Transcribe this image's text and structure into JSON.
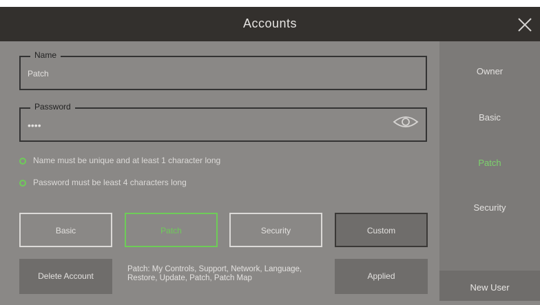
{
  "header": {
    "title": "Accounts"
  },
  "form": {
    "name_label": "Name",
    "name_value": "Patch",
    "password_label": "Password",
    "password_value": "••••"
  },
  "rules": [
    "Name must be unique and at least 1 character long",
    "Password must be least 4 characters long"
  ],
  "roles": {
    "basic": "Basic",
    "patch": "Patch",
    "security": "Security",
    "custom": "Custom"
  },
  "footer": {
    "delete": "Delete Account",
    "permissions": "Patch: My Controls, Support, Network, Language, Restore, Update, Patch, Patch Map",
    "applied": "Applied"
  },
  "sidebar": {
    "items": [
      "Owner",
      "Basic",
      "Patch",
      "Security"
    ],
    "active": "Patch",
    "new_user": "New User"
  },
  "colors": {
    "accent": "#6ecc58",
    "header_bg": "#33302d",
    "panel_bg": "#8a8886",
    "sidebar_bg": "#7c7a78"
  },
  "icons": [
    "close-icon",
    "eye-icon",
    "check-circle-icon"
  ]
}
